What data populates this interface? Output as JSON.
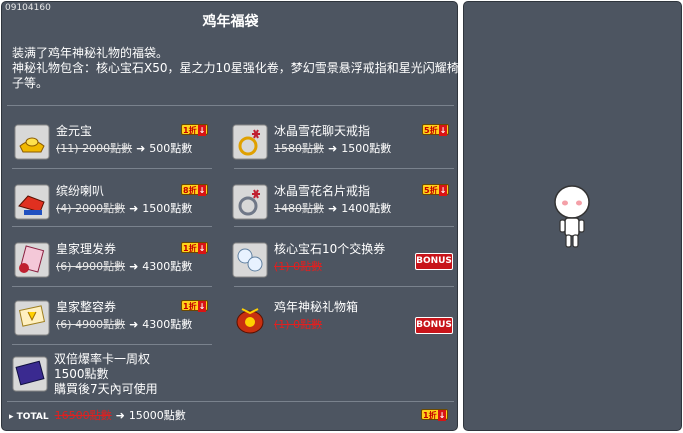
{
  "item_id": "09104160",
  "title": "鸡年福袋",
  "description": [
    "装满了鸡年神秘礼物的福袋。",
    "神秘礼物包含：核心宝石X50，星之力10星强化卷，梦幻雪景悬浮戒指和星光闪耀椅",
    "子等。"
  ],
  "items": [
    {
      "name": "金元宝",
      "original_price": "(11) 2000點數",
      "arrow": "➜",
      "price": "500點數",
      "discount": "1折",
      "icon": "gold-ingot-icon"
    },
    {
      "name": "冰晶雪花聊天戒指",
      "original_price": "1580點數",
      "arrow": "➜",
      "price": "1500點數",
      "discount": "5折",
      "icon": "snowflake-chat-ring-icon"
    },
    {
      "name": "缤纷喇叭",
      "original_price": "(4) 2000點數",
      "arrow": "➜",
      "price": "1500點數",
      "discount": "8折",
      "icon": "colorful-megaphone-icon"
    },
    {
      "name": "冰晶雪花名片戒指",
      "original_price": "1480點數",
      "arrow": "➜",
      "price": "1400點數",
      "discount": "5折",
      "icon": "snowflake-namecard-ring-icon"
    },
    {
      "name": "皇家理发券",
      "original_price": "(6) 4900點數",
      "arrow": "➜",
      "price": "4300點數",
      "discount": "1折",
      "icon": "royal-hair-coupon-icon"
    },
    {
      "name": "核心宝石10个交换券",
      "original_price": "(1) 0點數",
      "arrow": "",
      "price": "",
      "bonus": "BONUS",
      "icon": "core-gem-coupon-icon"
    },
    {
      "name": "皇家整容券",
      "original_price": "(6) 4900點數",
      "arrow": "➜",
      "price": "4300點數",
      "discount": "1折",
      "icon": "royal-face-coupon-icon"
    },
    {
      "name": "鸡年神秘礼物箱",
      "original_price": "(1) 0點數",
      "arrow": "",
      "price": "",
      "bonus": "BONUS",
      "icon": "mystery-gift-box-icon"
    }
  ],
  "double": {
    "name": "双倍爆率卡一周权",
    "price": "1500點數",
    "usage": "購買後7天內可使用",
    "icon": "double-drop-card-icon"
  },
  "total": {
    "label": "TOTAL",
    "original": "16500點數",
    "arrow": "➜",
    "price": "15000點數",
    "discount": "1折"
  },
  "colors": {
    "panel_bg": "#4d5561",
    "strike_red": "#e02020",
    "badge_yellow": "#ffd21a",
    "bonus_red": "#c8141a"
  }
}
